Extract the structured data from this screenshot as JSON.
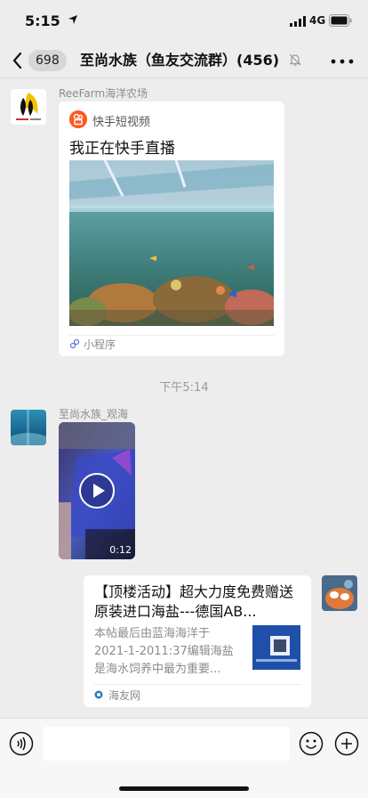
{
  "status_bar": {
    "time": "5:15",
    "network": "4G"
  },
  "nav": {
    "unread_count": "698",
    "title": "至尚水族（鱼友交流群）(456)"
  },
  "messages": {
    "first": {
      "sender": "ReeFarm海洋农场",
      "app_name": "快手短视频",
      "title": "我正在快手直播",
      "footer_label": "小程序"
    },
    "timestamp": "下午5:14",
    "second": {
      "sender": "至尚水族_观海",
      "video_duration": "0:12"
    },
    "third": {
      "title": "【顶楼活动】超大力度免费赠送原装进口海盐---德国AB...",
      "description": "本帖最后由蓝海海洋于 2021-1-2011:37编辑海盐是海水饲养中最为重要...",
      "source": "海友网"
    }
  },
  "input": {
    "placeholder": ""
  },
  "colors": {
    "background": "#ededed",
    "card": "#ffffff",
    "kuaishou_orange": "#ff5a1f",
    "muted_text": "#8c8c8c"
  },
  "icons": {
    "back": "chevron-left",
    "mute": "bell-slash",
    "more": "ellipsis",
    "play": "play-circle",
    "voice": "voice-wave",
    "emoji": "smiley",
    "add": "plus-circle"
  }
}
